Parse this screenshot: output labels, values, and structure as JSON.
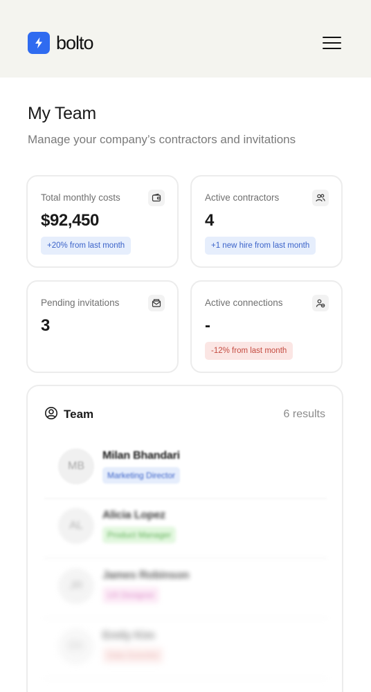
{
  "header": {
    "brand": "bolto",
    "logo_color": "#2f6bf0",
    "menu_icon": "hamburger-menu-icon"
  },
  "page": {
    "title": "My Team",
    "subtitle": "Manage your company’s contractors and invitations"
  },
  "stats": [
    {
      "label": "Total monthly costs",
      "value": "$92,450",
      "badge": "+20% from last month",
      "icon": "wallet-icon",
      "badge_tone": "blue"
    },
    {
      "label": "Active contractors",
      "value": "4",
      "badge": "+1 new hire from last month",
      "icon": "users-icon",
      "badge_tone": "blue"
    },
    {
      "label": "Pending invitations",
      "value": "3",
      "badge": "",
      "icon": "mail-open-icon",
      "badge_tone": ""
    },
    {
      "label": "Active connections",
      "value": "-",
      "badge": "-12% from last month",
      "icon": "user-link-icon",
      "badge_tone": "red"
    }
  ],
  "team": {
    "title": "Team",
    "count": "6 results",
    "icon": "user-circle-icon",
    "members": [
      {
        "initials": "MB",
        "name": "Milan Bhandari",
        "role": "Marketing Director",
        "role_color": "#3a62c8"
      },
      {
        "initials": "AL",
        "name": "Alicia Lopez",
        "role": "Product Manager",
        "role_color": "#44a33a"
      },
      {
        "initials": "JR",
        "name": "James Robinson",
        "role": "UX Designer",
        "role_color": "#d05eb6"
      },
      {
        "initials": "EK",
        "name": "Emily Kim",
        "role": "Data Scientist",
        "role_color": "#d06060"
      }
    ]
  }
}
